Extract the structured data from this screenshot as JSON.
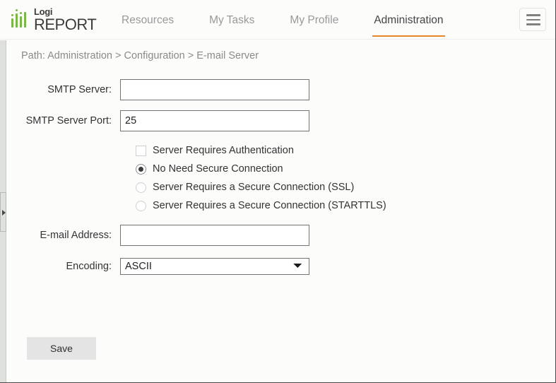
{
  "header": {
    "logo": {
      "name_top": "Logi",
      "name_bottom": "REPORT",
      "accent_color": "#7ab648"
    },
    "nav": [
      {
        "label": "Resources",
        "active": false
      },
      {
        "label": "My Tasks",
        "active": false
      },
      {
        "label": "My Profile",
        "active": false
      },
      {
        "label": "Administration",
        "active": true
      }
    ],
    "menu_icon": "hamburger-icon",
    "active_underline_color": "#e8842a"
  },
  "breadcrumb": {
    "text": "Path: Administration > Configuration > E-mail Server"
  },
  "form": {
    "smtp_server": {
      "label": "SMTP Server:",
      "value": "",
      "placeholder": ""
    },
    "smtp_server_port": {
      "label": "SMTP Server Port:",
      "value": "25",
      "placeholder": ""
    },
    "requires_auth": {
      "label": "Server Requires Authentication",
      "checked": false
    },
    "security_options": [
      {
        "label": "No Need Secure Connection",
        "selected": true
      },
      {
        "label": "Server Requires a Secure Connection (SSL)",
        "selected": false
      },
      {
        "label": "Server Requires a Secure Connection (STARTTLS)",
        "selected": false
      }
    ],
    "email_address": {
      "label": "E-mail Address:",
      "value": "",
      "placeholder": ""
    },
    "encoding": {
      "label": "Encoding:",
      "selected": "ASCII",
      "options": [
        "ASCII"
      ]
    }
  },
  "actions": {
    "save_label": "Save"
  },
  "splitter": {
    "expand_icon": "triangle-right-icon"
  }
}
